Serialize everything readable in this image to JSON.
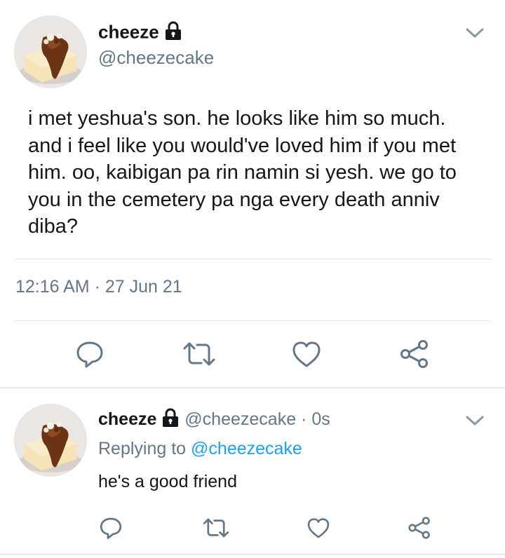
{
  "main_tweet": {
    "display_name": "cheeze",
    "handle": "@cheezecake",
    "text": "i met yeshua's son. he looks like him so much. and i feel like you would've loved him if you met him. oo, kaibigan pa rin namin si yesh. we go to you in the cemetery pa nga every death anniv diba?",
    "timestamp": "12:16 AM · 27 Jun 21",
    "icons": {
      "lock": "lock-icon",
      "menu": "chevron-down-icon",
      "reply": "reply-icon",
      "retweet": "retweet-icon",
      "like": "heart-icon",
      "share": "share-icon"
    }
  },
  "reply_tweet": {
    "display_name": "cheeze",
    "handle_time": "@cheezecake · 0s",
    "replying_prefix": "Replying to ",
    "replying_handle": "@cheezecake",
    "text": "he's a good friend"
  },
  "colors": {
    "primary_text": "#14171a",
    "secondary_text": "#657786",
    "link": "#1da1f2",
    "icon": "#657786",
    "divider": "#e1e8ed"
  }
}
